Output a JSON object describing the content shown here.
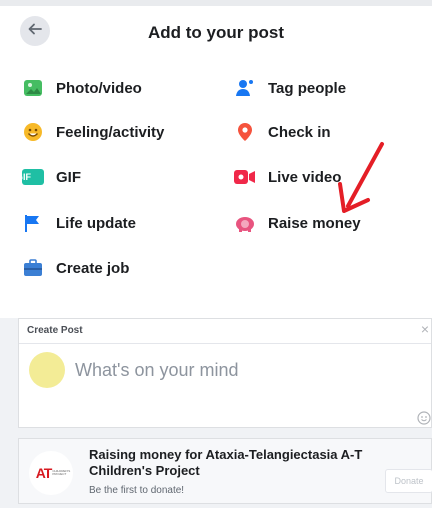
{
  "header": {
    "title": "Add to your post"
  },
  "options": {
    "photo_video": "Photo/video",
    "tag_people": "Tag people",
    "feeling_activity": "Feeling/activity",
    "check_in": "Check in",
    "gif": "GIF",
    "gif_badge": "GIF",
    "live_video": "Live video",
    "life_update": "Life update",
    "raise_money": "Raise money",
    "create_job": "Create job"
  },
  "create_post": {
    "title": "Create Post",
    "close": "×",
    "placeholder": "What's on your mind"
  },
  "fundraiser": {
    "title": "Raising money for Ataxia-Telangiectasia A-T Children's Project",
    "subtitle": "Be the first to donate!",
    "donate_label": "Donate",
    "logo_text": "AT",
    "logo_small": "CHILDREN'S PROJECT"
  },
  "colors": {
    "brand_blue": "#1877f2",
    "photo_green": "#45bd62",
    "feeling_yellow": "#f7b928",
    "check_in_red": "#f5533d",
    "live_red": "#f02849",
    "gif_teal": "#1fbfa4",
    "life_update_blue": "#1877f2",
    "raise_money_pink": "#e8547f",
    "job_blue": "#3b7fd4",
    "annotation_arrow": "#e41e26"
  },
  "icons": {
    "back": "back-arrow-icon",
    "photo_video": "photo-icon",
    "tag_people": "tag-people-icon",
    "feeling": "smiley-icon",
    "check_in": "map-pin-icon",
    "gif": "gif-icon",
    "live_video": "live-video-icon",
    "life_update": "flag-icon",
    "raise_money": "piggy-bank-icon",
    "create_job": "briefcase-icon",
    "emoji": "emoji-icon"
  }
}
